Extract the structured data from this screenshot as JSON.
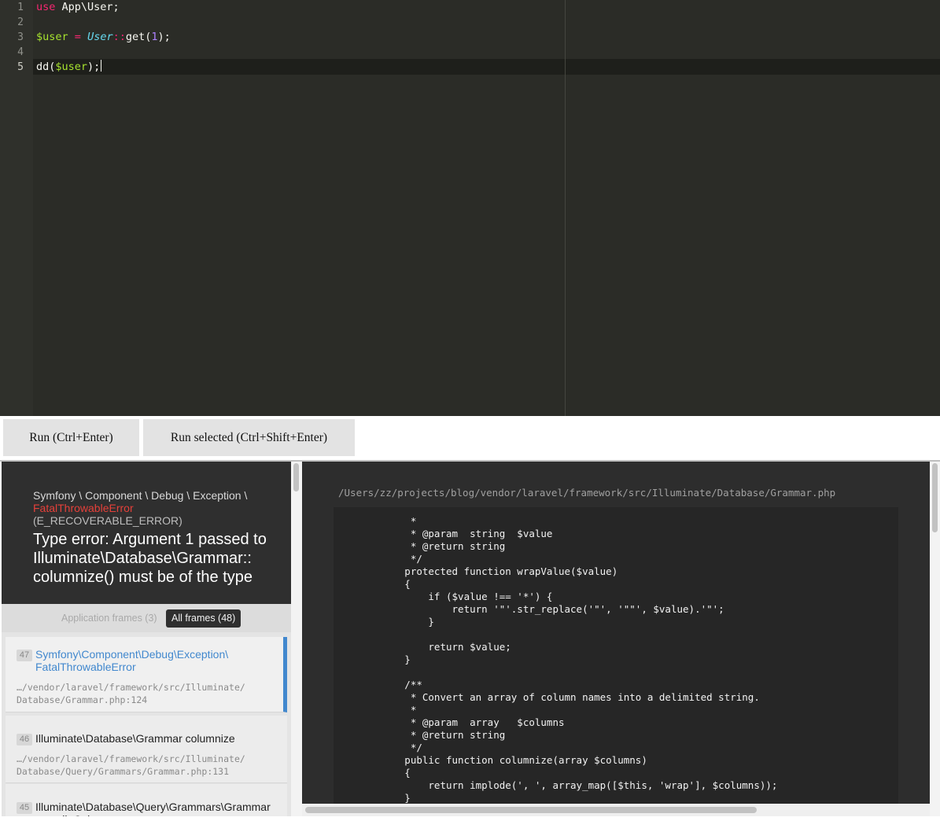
{
  "editor": {
    "line_numbers": [
      "1",
      "2",
      "3",
      "4",
      "5"
    ],
    "lines": [
      [
        {
          "t": "use",
          "c": "kw"
        },
        {
          "t": " App\\User;",
          "c": ""
        }
      ],
      [],
      [
        {
          "t": "$user",
          "c": "var"
        },
        {
          "t": " ",
          "c": ""
        },
        {
          "t": "=",
          "c": "kw"
        },
        {
          "t": " ",
          "c": ""
        },
        {
          "t": "User",
          "c": "cls"
        },
        {
          "t": "::",
          "c": "kw"
        },
        {
          "t": "get(",
          "c": ""
        },
        {
          "t": "1",
          "c": "num"
        },
        {
          "t": ");",
          "c": ""
        }
      ],
      [],
      [
        {
          "t": "dd(",
          "c": ""
        },
        {
          "t": "$user",
          "c": "var"
        },
        {
          "t": ");",
          "c": ""
        }
      ]
    ],
    "active_line": 5
  },
  "toolbar": {
    "run_label": "Run (Ctrl+Enter)",
    "run_selected_label": "Run selected (Ctrl+Shift+Enter)"
  },
  "exception": {
    "namespace": "Symfony \\ Component \\ Debug \\ Exception \\",
    "class_name": "FatalThrowableError",
    "code": "(E_RECOVERABLE_ERROR)",
    "message": "Type error: Argument 1 passed to Illuminate\\Database\\Grammar:: columnize() must be of the type"
  },
  "frame_filter": {
    "application_label": "Application frames (3)",
    "all_label": "All frames (48)"
  },
  "frames": [
    {
      "index": "47",
      "class": "Symfony\\Component\\Debug\\Exception\\ FatalThrowableError",
      "file": "…/vendor/laravel/framework/src/Illuminate/ Database/Grammar.php:124",
      "active": true
    },
    {
      "index": "46",
      "class": "Illuminate\\Database\\Grammar columnize",
      "file": "…/vendor/laravel/framework/src/Illuminate/ Database/Query/Grammars/Grammar.php:131",
      "active": false
    },
    {
      "index": "45",
      "class": "Illuminate\\Database\\Query\\Grammars\\Grammar compileColumns",
      "file": "",
      "active": false
    }
  ],
  "source": {
    "file_path": "/Users/zz/projects/blog/vendor/laravel/framework/src/Illuminate/Database/Grammar.php",
    "lines": [
      "             *",
      "             * @param  string  $value",
      "             * @return string",
      "             */",
      "            protected function wrapValue($value)",
      "            {",
      "                if ($value !== '*') {",
      "                    return '\"'.str_replace('\"', '\"\"', $value).'\"';",
      "                }",
      "",
      "                return $value;",
      "            }",
      "",
      "            /**",
      "             * Convert an array of column names into a delimited string.",
      "             *",
      "             * @param  array   $columns",
      "             * @return string",
      "             */",
      "            public function columnize(array $columns)",
      "            {",
      "                return implode(', ', array_map([$this, 'wrap'], $columns));",
      "            }"
    ]
  }
}
